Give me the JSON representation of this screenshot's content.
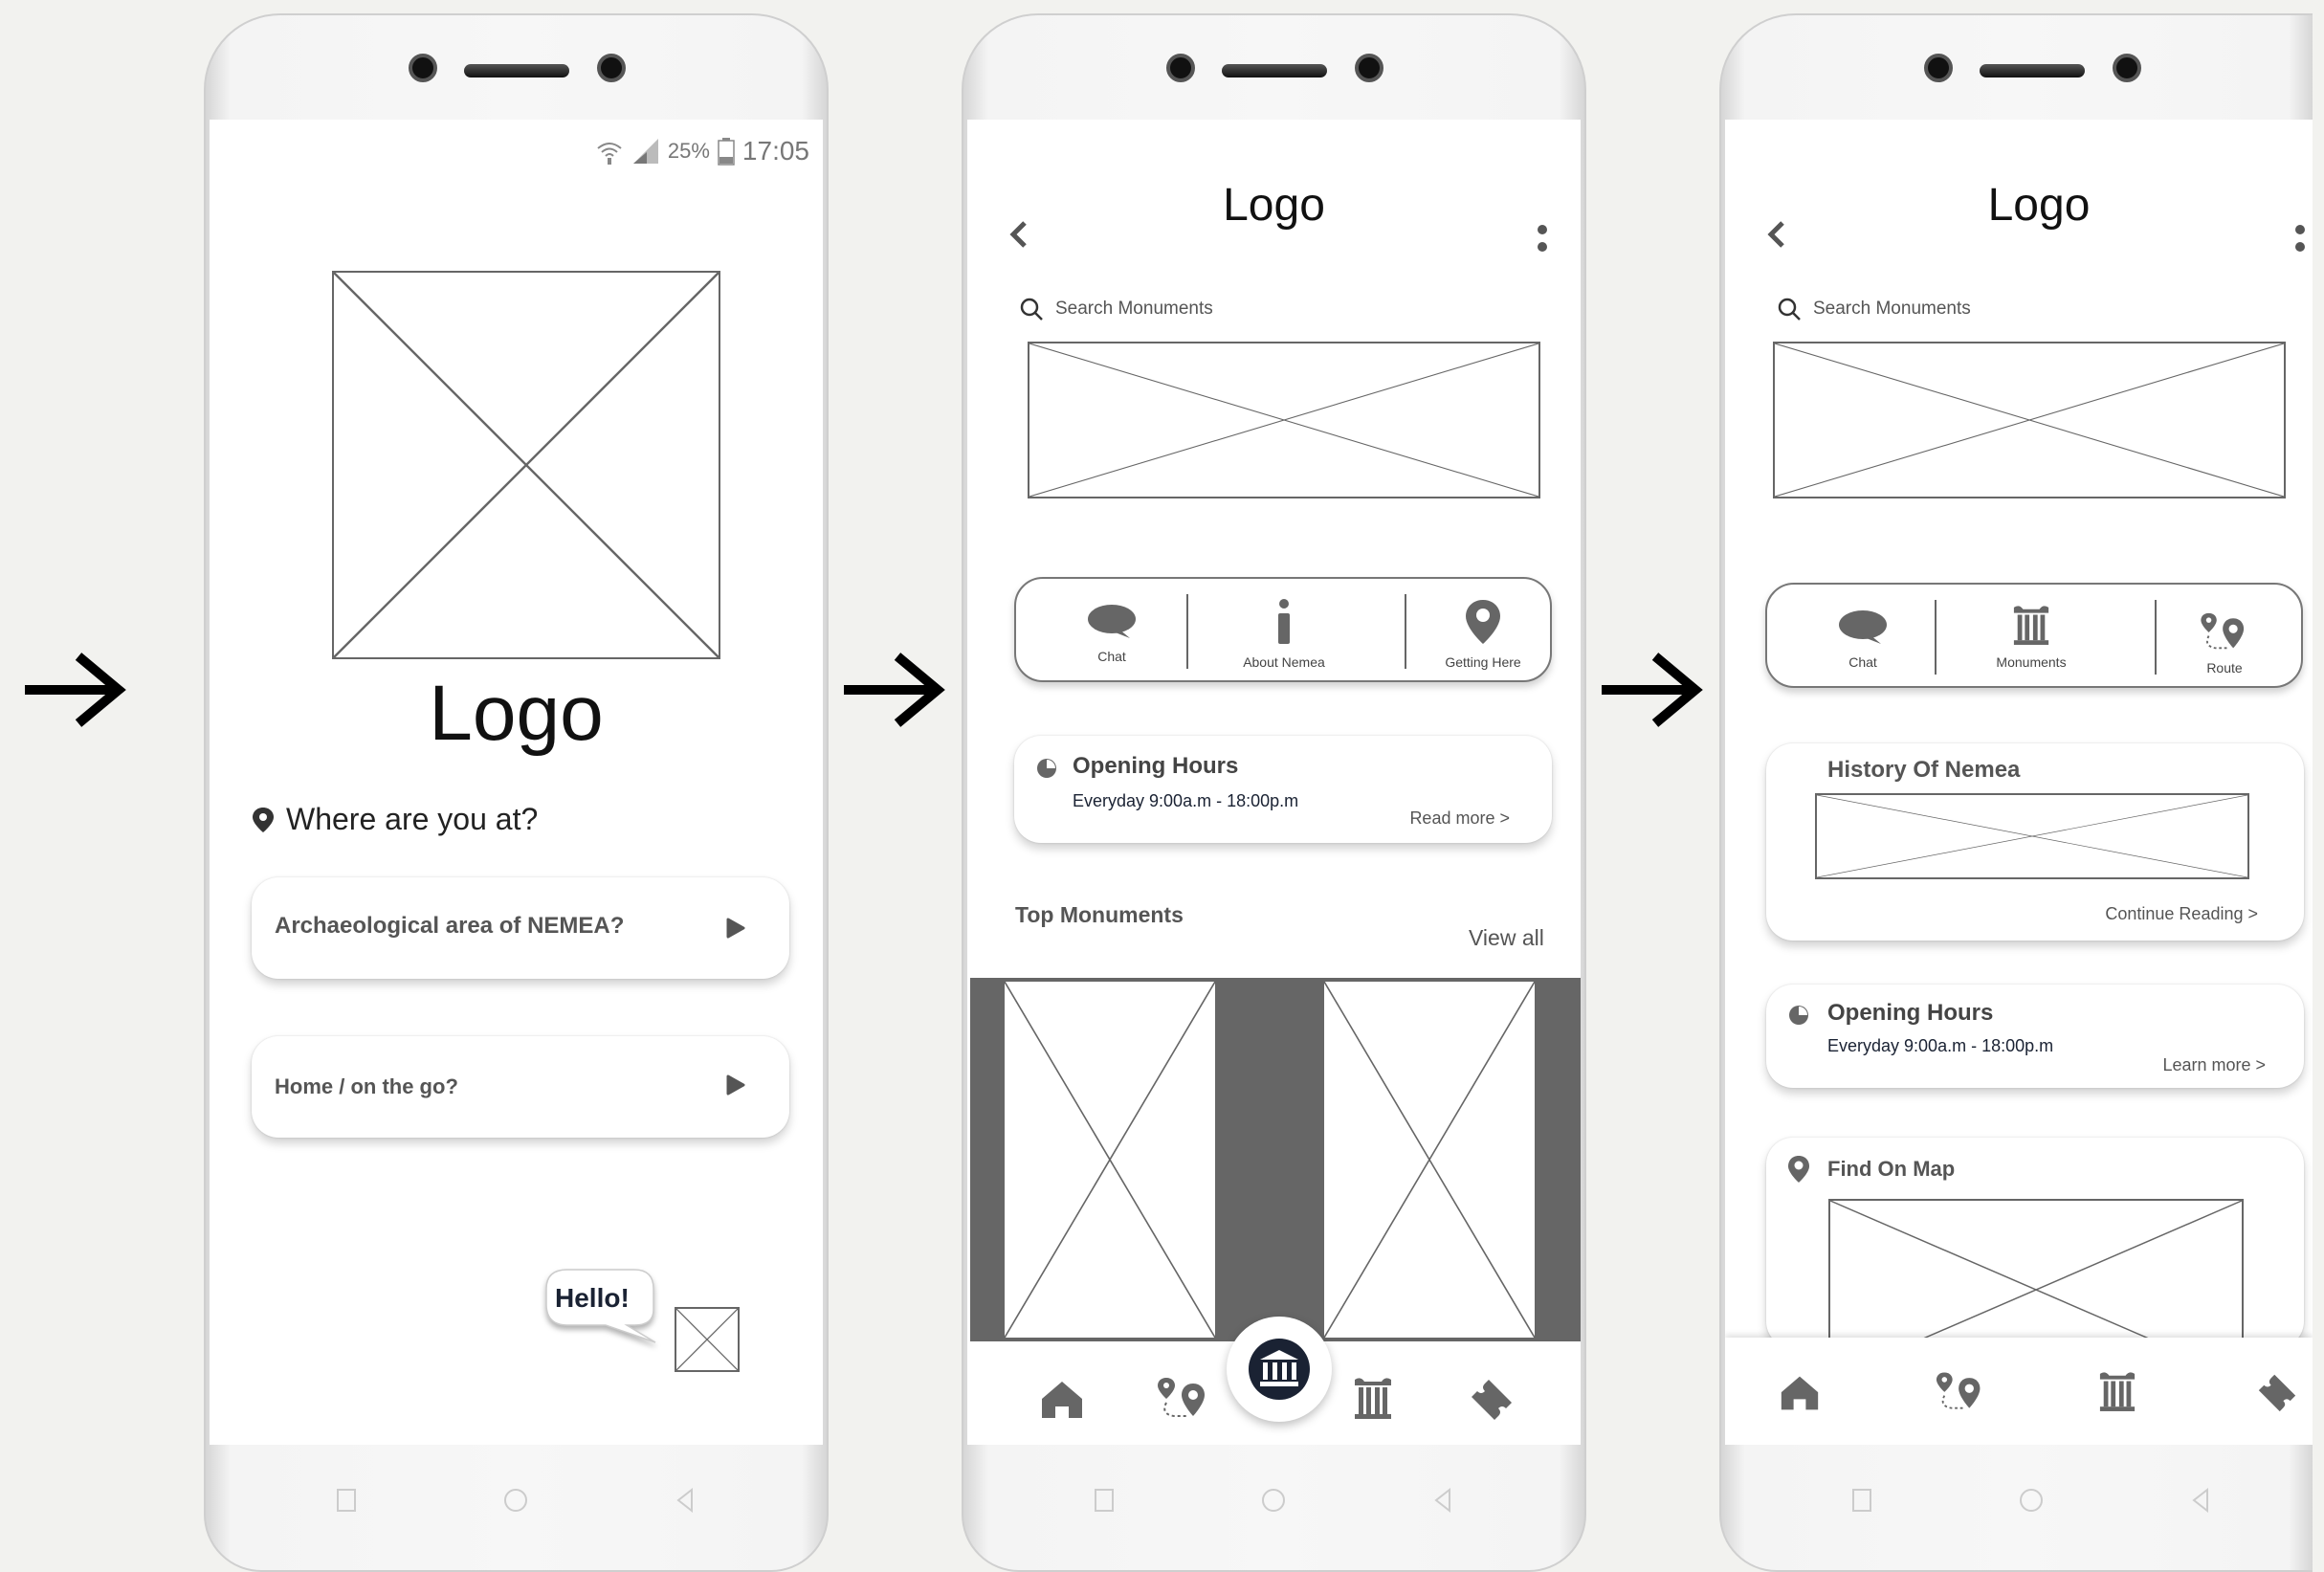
{
  "screens": [
    {
      "status": {
        "battery": "25%",
        "time": "17:05"
      },
      "logo": "Logo",
      "question": "Where are you at?",
      "options": [
        {
          "label": "Archaeological area of NEMEA?"
        },
        {
          "label": "Home / on the go?"
        }
      ],
      "chat_bubble": "Hello!"
    },
    {
      "logo": "Logo",
      "search_placeholder": "Search Monuments",
      "menu": [
        {
          "label": "Chat",
          "icon": "chat-icon"
        },
        {
          "label": "About Nemea",
          "icon": "info-icon"
        },
        {
          "label": "Getting Here",
          "icon": "map-pin-icon"
        }
      ],
      "opening_hours": {
        "title": "Opening Hours",
        "hours": "Everyday  9:00a.m - 18:00p.m",
        "link": "Read more >"
      },
      "top_monuments": {
        "title": "Top Monuments",
        "view_all": "View all"
      },
      "bottom_nav": [
        "home-icon",
        "route-icon",
        "museum-icon",
        "column-icon",
        "ticket-icon"
      ]
    },
    {
      "logo": "Logo",
      "search_placeholder": "Search Monuments",
      "menu": [
        {
          "label": "Chat",
          "icon": "chat-icon"
        },
        {
          "label": "Monuments",
          "icon": "column-icon"
        },
        {
          "label": "Route",
          "icon": "route-icon"
        }
      ],
      "history": {
        "title": "History Of Nemea",
        "link": "Continue Reading >"
      },
      "opening_hours": {
        "title": "Opening Hours",
        "hours": "Everyday  9:00a.m - 18:00p.m",
        "link": "Learn more >"
      },
      "find_on_map": {
        "title": "Find On Map"
      },
      "bottom_nav": [
        "home-icon",
        "route-icon",
        "column-icon",
        "ticket-icon"
      ]
    }
  ],
  "colors": {
    "icon_gray": "#666666",
    "text_dark": "#111111",
    "navy": "#1a2233"
  }
}
